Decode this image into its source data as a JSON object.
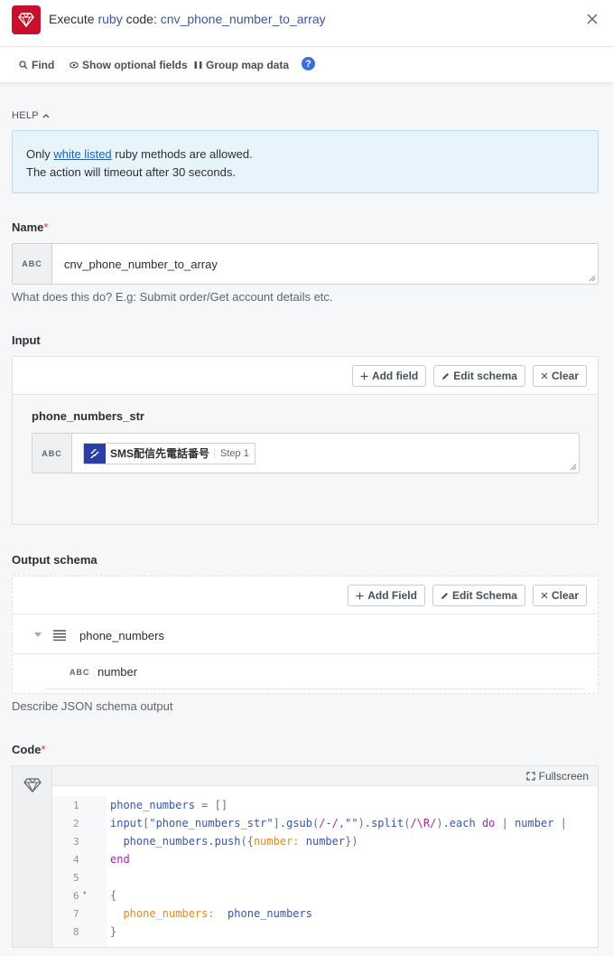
{
  "header": {
    "title_prefix": "Execute ",
    "title_accent1": "ruby",
    "title_mid": " code: ",
    "title_accent2": "cnv_phone_number_to_array"
  },
  "toolbar": {
    "find": "Find",
    "show_optional": "Show optional fields",
    "group_map": "Group map data",
    "help_icon": "?"
  },
  "help": {
    "label": "HELP",
    "line1_prefix": "Only ",
    "line1_link": "white listed",
    "line1_suffix": " ruby methods are allowed.",
    "line2": "The action will timeout after 30 seconds."
  },
  "name_field": {
    "label": "Name",
    "required_mark": "*",
    "type_badge": "ABC",
    "value": "cnv_phone_number_to_array",
    "hint": "What does this do? E.g: Submit order/Get account details etc."
  },
  "input_section": {
    "label": "Input",
    "add_field": "Add field",
    "edit_schema": "Edit schema",
    "clear": "Clear",
    "field_name": "phone_numbers_str",
    "type_badge": "ABC",
    "pill_text": "SMS配信先電話番号",
    "pill_step": "Step 1"
  },
  "output_schema": {
    "label": "Output schema",
    "add_field": "Add Field",
    "edit_schema": "Edit Schema",
    "clear": "Clear",
    "array_name": "phone_numbers",
    "child_type": "ABC",
    "child_name": "number",
    "hint": "Describe JSON schema output"
  },
  "code": {
    "label": "Code",
    "required_mark": "*",
    "fullscreen": "Fullscreen",
    "line_numbers": [
      "1",
      "2",
      "3",
      "4",
      "5",
      "6",
      "7",
      "8"
    ],
    "fold_marker": "▾"
  }
}
